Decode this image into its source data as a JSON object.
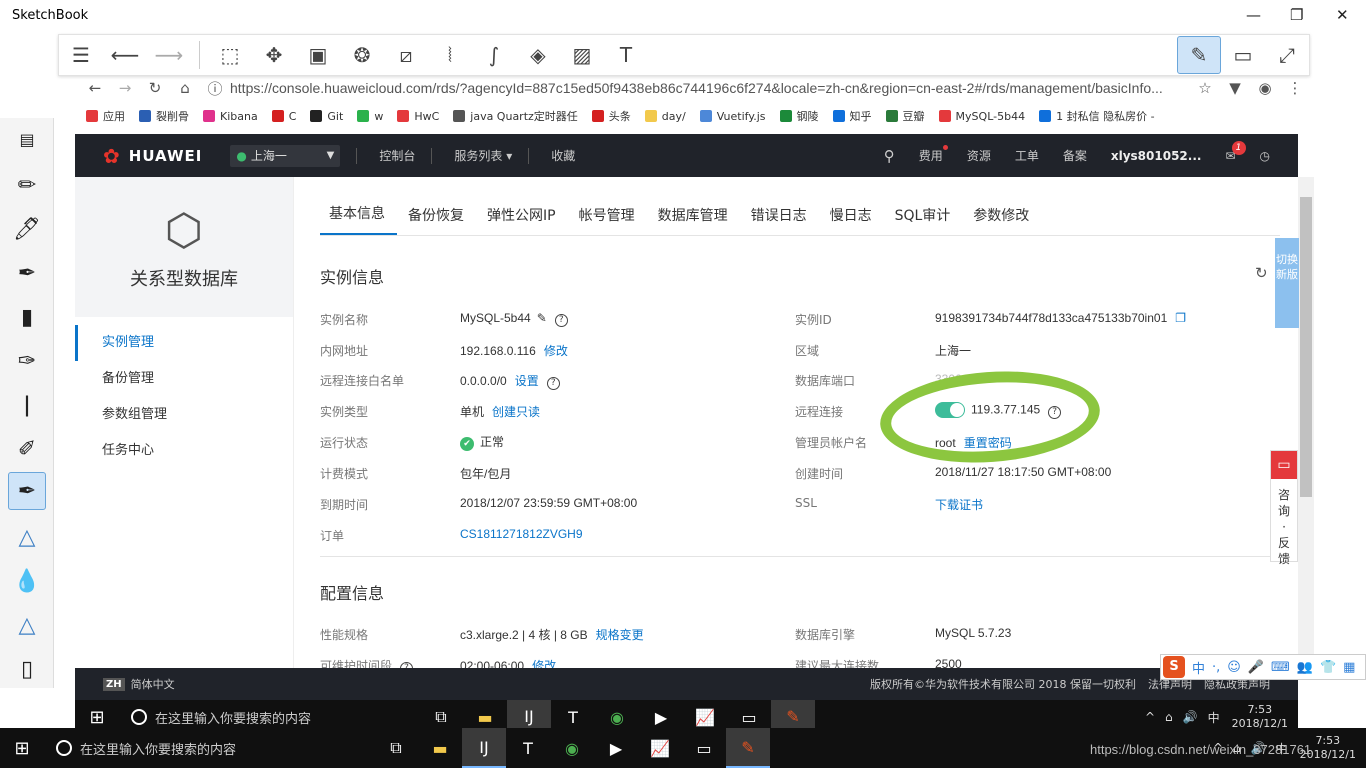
{
  "sketchbook": {
    "title": "SketchBook"
  },
  "browser": {
    "url": "https://console.huaweicloud.com/rds/?agencyId=887c15ed50f9438eb86c744196c6f274&locale=zh-cn&region=cn-east-2#/rds/management/basicInfo...",
    "bookmarks": [
      "应用",
      "裂削骨",
      "Kibana",
      "C",
      "Git",
      "w",
      "HwC",
      "java Quartz定时器任",
      "头条",
      "day/",
      "Vuetify.js",
      "钢陵",
      "知乎",
      "豆瓣",
      "MySQL-5b44",
      "1 封私信 隐私房价 -"
    ]
  },
  "header": {
    "brand": "HUAWEI",
    "region": "上海一",
    "nav": [
      "控制台",
      "服务列表",
      "收藏"
    ],
    "right": [
      "费用",
      "资源",
      "工单",
      "备案",
      "xlys801052..."
    ],
    "mail_badge": "1"
  },
  "sidebar": {
    "title": "关系型数据库",
    "items": [
      "实例管理",
      "备份管理",
      "参数组管理",
      "任务中心"
    ]
  },
  "tabs": [
    "基本信息",
    "备份恢复",
    "弹性公网IP",
    "帐号管理",
    "数据库管理",
    "错误日志",
    "慢日志",
    "SQL审计",
    "参数修改"
  ],
  "instance": {
    "section_title": "实例信息",
    "left": [
      {
        "label": "实例名称",
        "value": "MySQL-5b44"
      },
      {
        "label": "内网地址",
        "value": "192.168.0.116",
        "link": "修改"
      },
      {
        "label": "远程连接白名单",
        "value": "0.0.0.0/0",
        "link": "设置"
      },
      {
        "label": "实例类型",
        "value": "单机",
        "link": "创建只读"
      },
      {
        "label": "运行状态",
        "value": "正常"
      },
      {
        "label": "计费模式",
        "value": "包年/包月"
      },
      {
        "label": "到期时间",
        "value": "2018/12/07 23:59:59 GMT+08:00"
      },
      {
        "label": "订单",
        "value": "CS1811271812ZVGH9"
      }
    ],
    "right": [
      {
        "label": "实例ID",
        "value": "9198391734b744f78d133ca475133b70in01"
      },
      {
        "label": "区域",
        "value": "上海一"
      },
      {
        "label": "数据库端口",
        "value": "3306"
      },
      {
        "label": "远程连接",
        "value": "119.3.77.145"
      },
      {
        "label": "管理员帐户名",
        "value": "root",
        "link": "重置密码"
      },
      {
        "label": "创建时间",
        "value": "2018/11/27 18:17:50 GMT+08:00"
      },
      {
        "label": "SSL",
        "link": "下载证书"
      }
    ]
  },
  "config": {
    "section_title": "配置信息",
    "left": [
      {
        "label": "性能规格",
        "value": "c3.xlarge.2 | 4 核 | 8 GB",
        "link": "规格变更"
      },
      {
        "label": "可维护时间段",
        "value": "02:00-06:00",
        "link": "修改"
      }
    ],
    "right": [
      {
        "label": "数据库引擎",
        "value": "MySQL 5.7.23"
      },
      {
        "label": "建议最大连接数",
        "value": "2500"
      }
    ]
  },
  "floating": {
    "switch_new": "切换新版",
    "consult": "咨询·反馈"
  },
  "footer": {
    "lang_icon": "ZH",
    "lang": "简体中文",
    "copyright": "版权所有©华为软件技术有限公司 2018 保留一切权利",
    "links": [
      "法律声明",
      "隐私政策声明"
    ]
  },
  "taskbar": {
    "search_placeholder": "在这里输入你要搜索的内容",
    "time": "7:53",
    "date": "2018/12/1",
    "ime": "中"
  },
  "watermark": "https://blog.csdn.net/weixin_37281761",
  "colors": {
    "accent": "#0a74c9",
    "header_bg": "#20232a",
    "annotation": "#8cc63f",
    "ok": "#3dbc6f"
  }
}
